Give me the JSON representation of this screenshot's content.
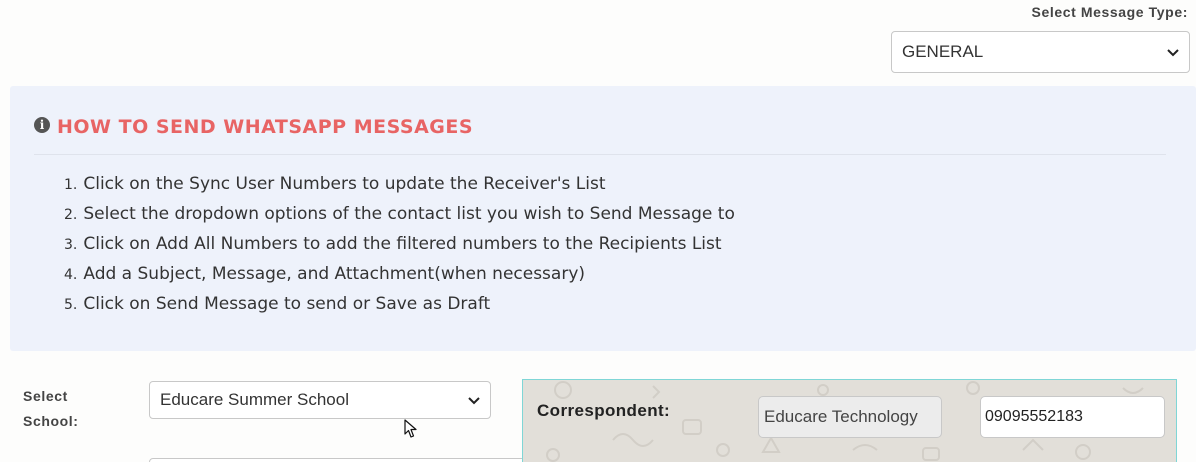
{
  "message_type": {
    "label": "Select Message Type:",
    "selected": "GENERAL"
  },
  "info": {
    "title": "HOW TO SEND WHATSAPP MESSAGES",
    "icon": "info-icon",
    "steps": [
      {
        "num": "1.",
        "text": "Click on the Sync User Numbers to update the Receiver's List"
      },
      {
        "num": "2.",
        "text": "Select the dropdown options of the contact list you wish to Send Message to"
      },
      {
        "num": "3.",
        "text": "Click on Add All Numbers to add the filtered numbers to the Recipients List"
      },
      {
        "num": "4.",
        "text": "Add a Subject, Message, and Attachment(when necessary)"
      },
      {
        "num": "5.",
        "text": "Click on Send Message to send or Save as Draft"
      }
    ]
  },
  "school": {
    "label_line1": "Select",
    "label_line2": "School:",
    "selected": "Educare Summer School"
  },
  "correspondent": {
    "label": "Correspondent:",
    "name": "Educare Technology",
    "phone": "09095552183"
  },
  "colors": {
    "title": "#e86464",
    "panel": "#eef2fb",
    "chat_border": "#7fd6d6"
  }
}
